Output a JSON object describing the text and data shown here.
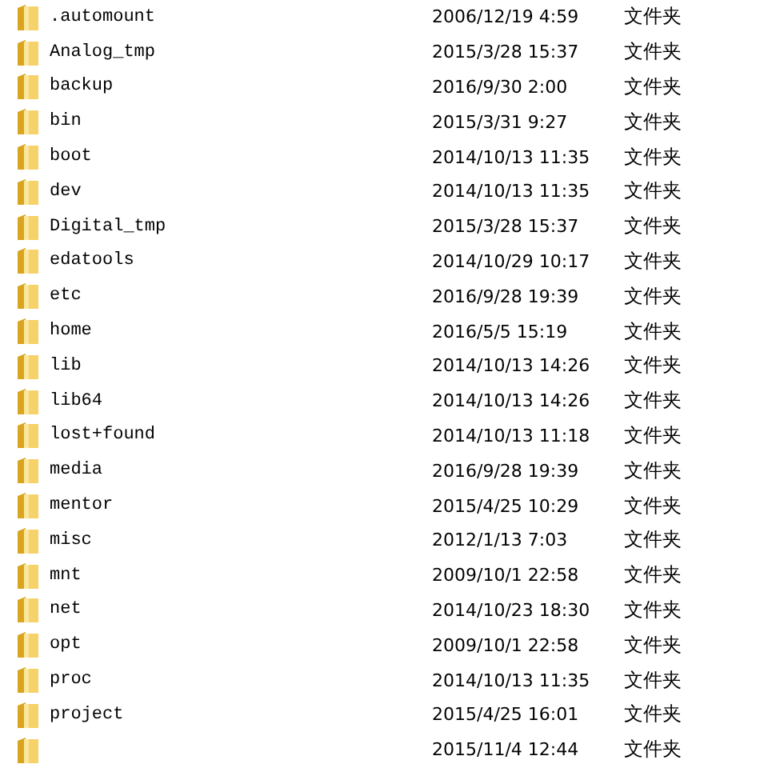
{
  "files": [
    {
      "name": ".automount",
      "modified": "2006/12/19 4:59",
      "type": "文件夹"
    },
    {
      "name": "Analog_tmp",
      "modified": "2015/3/28 15:37",
      "type": "文件夹"
    },
    {
      "name": "backup",
      "modified": "2016/9/30 2:00",
      "type": "文件夹"
    },
    {
      "name": "bin",
      "modified": "2015/3/31 9:27",
      "type": "文件夹"
    },
    {
      "name": "boot",
      "modified": "2014/10/13 11:35",
      "type": "文件夹"
    },
    {
      "name": "dev",
      "modified": "2014/10/13 11:35",
      "type": "文件夹"
    },
    {
      "name": "Digital_tmp",
      "modified": "2015/3/28 15:37",
      "type": "文件夹"
    },
    {
      "name": "edatools",
      "modified": "2014/10/29 10:17",
      "type": "文件夹"
    },
    {
      "name": "etc",
      "modified": "2016/9/28 19:39",
      "type": "文件夹"
    },
    {
      "name": "home",
      "modified": "2016/5/5 15:19",
      "type": "文件夹"
    },
    {
      "name": "lib",
      "modified": "2014/10/13 14:26",
      "type": "文件夹"
    },
    {
      "name": "lib64",
      "modified": "2014/10/13 14:26",
      "type": "文件夹"
    },
    {
      "name": "lost+found",
      "modified": "2014/10/13 11:18",
      "type": "文件夹"
    },
    {
      "name": "media",
      "modified": "2016/9/28 19:39",
      "type": "文件夹"
    },
    {
      "name": "mentor",
      "modified": "2015/4/25 10:29",
      "type": "文件夹"
    },
    {
      "name": "misc",
      "modified": "2012/1/13 7:03",
      "type": "文件夹"
    },
    {
      "name": "mnt",
      "modified": "2009/10/1 22:58",
      "type": "文件夹"
    },
    {
      "name": "net",
      "modified": "2014/10/23 18:30",
      "type": "文件夹"
    },
    {
      "name": "opt",
      "modified": "2009/10/1 22:58",
      "type": "文件夹"
    },
    {
      "name": "proc",
      "modified": "2014/10/13 11:35",
      "type": "文件夹"
    },
    {
      "name": "project",
      "modified": "2015/4/25 16:01",
      "type": "文件夹"
    },
    {
      "modified": "2015/11/4 12:44",
      "type": "文件夹"
    }
  ]
}
